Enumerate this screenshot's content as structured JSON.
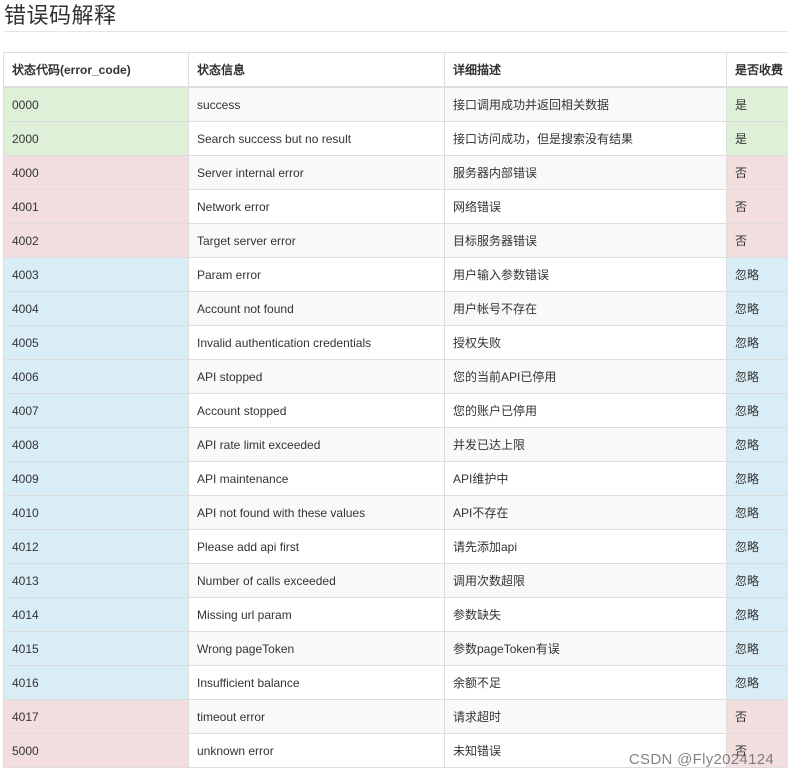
{
  "page": {
    "title": "错误码解释",
    "watermark": "CSDN @Fly2024124"
  },
  "colors": {
    "success": "#dff0d8",
    "danger": "#f2dede",
    "info": "#d9edf7",
    "stripe": "#f9f9f9",
    "border": "#dddddd"
  },
  "table": {
    "headers": [
      "状态代码(error_code)",
      "状态信息",
      "详细描述",
      "是否收费"
    ],
    "rows": [
      {
        "code": "0000",
        "message": "success",
        "description": "接口调用成功并返回相关数据",
        "charged": "是",
        "status": "success"
      },
      {
        "code": "2000",
        "message": "Search success but no result",
        "description": "接口访问成功，但是搜索没有结果",
        "charged": "是",
        "status": "success"
      },
      {
        "code": "4000",
        "message": "Server internal error",
        "description": "服务器内部错误",
        "charged": "否",
        "status": "danger"
      },
      {
        "code": "4001",
        "message": "Network error",
        "description": "网络错误",
        "charged": "否",
        "status": "danger"
      },
      {
        "code": "4002",
        "message": "Target server error",
        "description": "目标服务器错误",
        "charged": "否",
        "status": "danger"
      },
      {
        "code": "4003",
        "message": "Param error",
        "description": "用户输入参数错误",
        "charged": "忽略",
        "status": "info"
      },
      {
        "code": "4004",
        "message": "Account not found",
        "description": "用户帐号不存在",
        "charged": "忽略",
        "status": "info"
      },
      {
        "code": "4005",
        "message": "Invalid authentication credentials",
        "description": "授权失败",
        "charged": "忽略",
        "status": "info"
      },
      {
        "code": "4006",
        "message": "API stopped",
        "description": "您的当前API已停用",
        "charged": "忽略",
        "status": "info"
      },
      {
        "code": "4007",
        "message": "Account stopped",
        "description": "您的账户已停用",
        "charged": "忽略",
        "status": "info"
      },
      {
        "code": "4008",
        "message": "API rate limit exceeded",
        "description": "并发已达上限",
        "charged": "忽略",
        "status": "info"
      },
      {
        "code": "4009",
        "message": "API maintenance",
        "description": "API维护中",
        "charged": "忽略",
        "status": "info"
      },
      {
        "code": "4010",
        "message": "API not found with these values",
        "description": "API不存在",
        "charged": "忽略",
        "status": "info"
      },
      {
        "code": "4012",
        "message": "Please add api first",
        "description": "请先添加api",
        "charged": "忽略",
        "status": "info"
      },
      {
        "code": "4013",
        "message": "Number of calls exceeded",
        "description": "调用次数超限",
        "charged": "忽略",
        "status": "info"
      },
      {
        "code": "4014",
        "message": "Missing url param",
        "description": "参数缺失",
        "charged": "忽略",
        "status": "info"
      },
      {
        "code": "4015",
        "message": "Wrong pageToken",
        "description": "参数pageToken有误",
        "charged": "忽略",
        "status": "info"
      },
      {
        "code": "4016",
        "message": "Insufficient balance",
        "description": "余额不足",
        "charged": "忽略",
        "status": "info"
      },
      {
        "code": "4017",
        "message": "timeout error",
        "description": "请求超时",
        "charged": "否",
        "status": "danger"
      },
      {
        "code": "5000",
        "message": "unknown error",
        "description": "未知错误",
        "charged": "否",
        "status": "danger"
      }
    ]
  }
}
